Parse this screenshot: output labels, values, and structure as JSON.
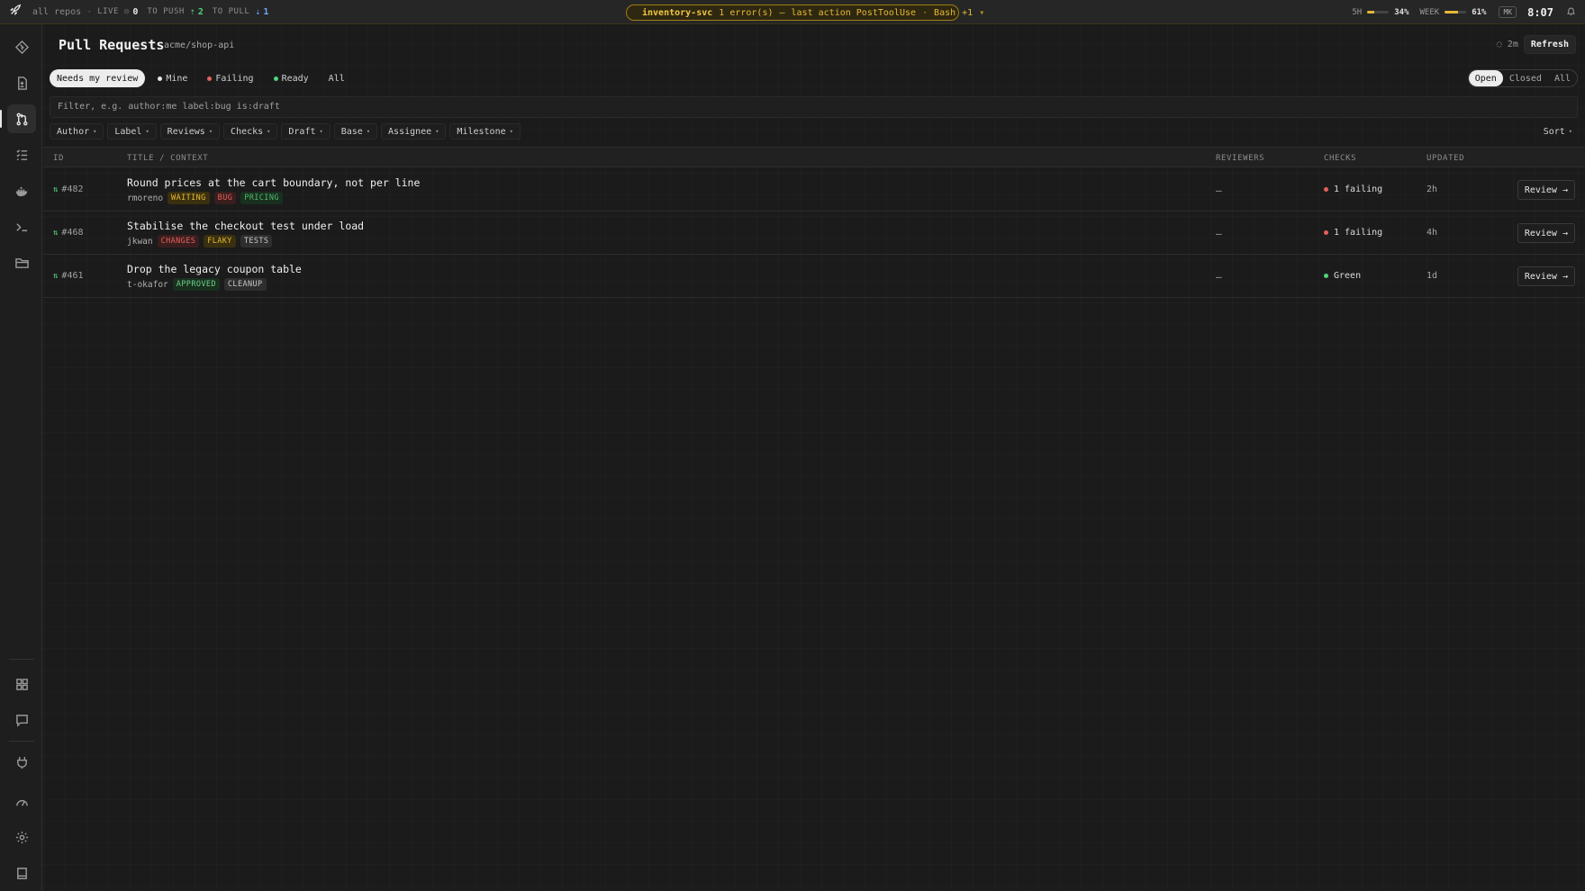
{
  "topbar": {
    "scope": "all repos",
    "live_label": "LIVE",
    "live_count": "0",
    "to_push_label": "TO PUSH",
    "to_push_count": "2",
    "to_pull_label": "TO PULL",
    "to_pull_count": "1",
    "alert": {
      "service": "inventory-svc",
      "errors": "1 error(s)",
      "sep": "—",
      "last_action": "last action PostToolUse",
      "tool": "Bash",
      "more": "+1"
    },
    "usage_5h_label": "5H",
    "usage_5h_value": "34%",
    "usage_5h_fraction": 0.34,
    "usage_week_label": "WEEK",
    "usage_week_value": "61%",
    "usage_week_fraction": 0.61,
    "user_initials": "MK",
    "clock": "8:07"
  },
  "sidebar": {
    "items": [
      {
        "icon": "git-diamond-icon"
      },
      {
        "icon": "file-diff-icon"
      },
      {
        "icon": "pull-request-icon",
        "active": true
      },
      {
        "icon": "checklist-icon"
      },
      {
        "icon": "docker-whale-icon"
      },
      {
        "icon": "terminal-icon"
      },
      {
        "icon": "folder-icon"
      }
    ],
    "bottom_items": [
      {
        "icon": "dashboard-grid-icon"
      },
      {
        "icon": "chat-icon"
      },
      {
        "icon": "plug-icon"
      },
      {
        "icon": "gauge-icon"
      },
      {
        "icon": "settings-gear-icon"
      },
      {
        "icon": "book-icon"
      }
    ]
  },
  "header": {
    "title": "Pull Requests",
    "repo": "acme/shop-api",
    "updated_ago": "2m",
    "refresh_label": "Refresh"
  },
  "quick_filters": [
    {
      "label": "Needs my review",
      "active": true
    },
    {
      "label": "Mine",
      "dot": "#e6e6e6"
    },
    {
      "label": "Failing",
      "dot": "#e5605a"
    },
    {
      "label": "Ready",
      "dot": "#4fd67a"
    },
    {
      "label": "All"
    }
  ],
  "state_toggle": {
    "options": [
      "Open",
      "Closed",
      "All"
    ],
    "selected": "Open"
  },
  "filter": {
    "placeholder": "Filter, e.g. author:me label:bug is:draft"
  },
  "facets": [
    "Author",
    "Label",
    "Reviews",
    "Checks",
    "Draft",
    "Base",
    "Assignee",
    "Milestone"
  ],
  "sort_label": "Sort",
  "table": {
    "columns": {
      "id": "ID",
      "title": "TITLE / CONTEXT",
      "reviewers": "REVIEWERS",
      "checks": "CHECKS",
      "updated": "UPDATED"
    },
    "rows": [
      {
        "id": "#482",
        "title": "Round prices at the cart boundary, not per line",
        "author": "rmoreno",
        "tags": [
          {
            "text": "WAITING",
            "kind": "waiting"
          },
          {
            "text": "BUG",
            "kind": "bug"
          },
          {
            "text": "PRICING",
            "kind": "pricing"
          }
        ],
        "reviewers": "—",
        "checks": "1 failing",
        "checks_color": "#e5605a",
        "updated": "2h",
        "action": "Review →"
      },
      {
        "id": "#468",
        "title": "Stabilise the checkout test under load",
        "author": "jkwan",
        "tags": [
          {
            "text": "CHANGES",
            "kind": "changes"
          },
          {
            "text": "FLAKY",
            "kind": "flaky"
          },
          {
            "text": "TESTS",
            "kind": "tests"
          }
        ],
        "reviewers": "—",
        "checks": "1 failing",
        "checks_color": "#e5605a",
        "updated": "4h",
        "action": "Review →"
      },
      {
        "id": "#461",
        "title": "Drop the legacy coupon table",
        "author": "t-okafor",
        "tags": [
          {
            "text": "APPROVED",
            "kind": "approved"
          },
          {
            "text": "CLEANUP",
            "kind": "cleanup"
          }
        ],
        "reviewers": "—",
        "checks": "Green",
        "checks_color": "#4fd67a",
        "updated": "1d",
        "action": "Review →"
      }
    ]
  }
}
